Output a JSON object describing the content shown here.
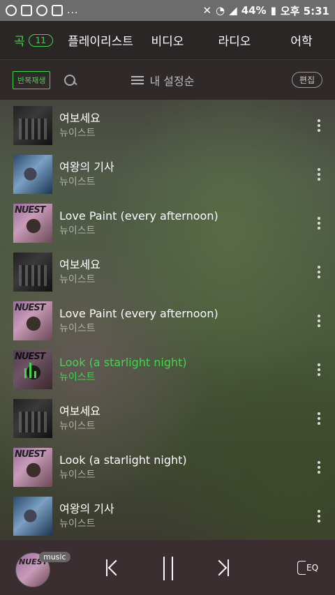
{
  "status": {
    "battery": "44%",
    "time_label": "오후 5:31",
    "dots": "..."
  },
  "tabs": {
    "items": [
      {
        "label": "곡",
        "badge": "11"
      },
      {
        "label": "플레이리스트"
      },
      {
        "label": "비디오"
      },
      {
        "label": "라디오"
      },
      {
        "label": "어학"
      }
    ]
  },
  "toolbar": {
    "repeat_label": "반복재생",
    "sort_label": "내 설정순",
    "edit_label": "편집"
  },
  "songs": [
    {
      "title": "여보세요",
      "artist": "뉴이스트",
      "art": "dark",
      "active": false
    },
    {
      "title": "여왕의 기사",
      "artist": "뉴이스트",
      "art": "blue",
      "active": false
    },
    {
      "title": "Love Paint (every afternoon)",
      "artist": "뉴이스트",
      "art": "nuest",
      "active": false
    },
    {
      "title": "여보세요",
      "artist": "뉴이스트",
      "art": "dark",
      "active": false
    },
    {
      "title": "Love Paint (every afternoon)",
      "artist": "뉴이스트",
      "art": "nuest",
      "active": false
    },
    {
      "title": "Look (a starlight night)",
      "artist": "뉴이스트",
      "art": "nuest",
      "active": true
    },
    {
      "title": "여보세요",
      "artist": "뉴이스트",
      "art": "dark",
      "active": false
    },
    {
      "title": "Look (a starlight night)",
      "artist": "뉴이스트",
      "art": "nuest",
      "active": false
    },
    {
      "title": "여왕의 기사",
      "artist": "뉴이스트",
      "art": "blue",
      "active": false
    }
  ],
  "album_logo_text": "NUEST",
  "player": {
    "badge": "music",
    "eq_label": "EQ"
  },
  "colors": {
    "accent": "#3fd84a",
    "tab_bar": "#2a2626",
    "status_bar": "#6b6c6b"
  }
}
